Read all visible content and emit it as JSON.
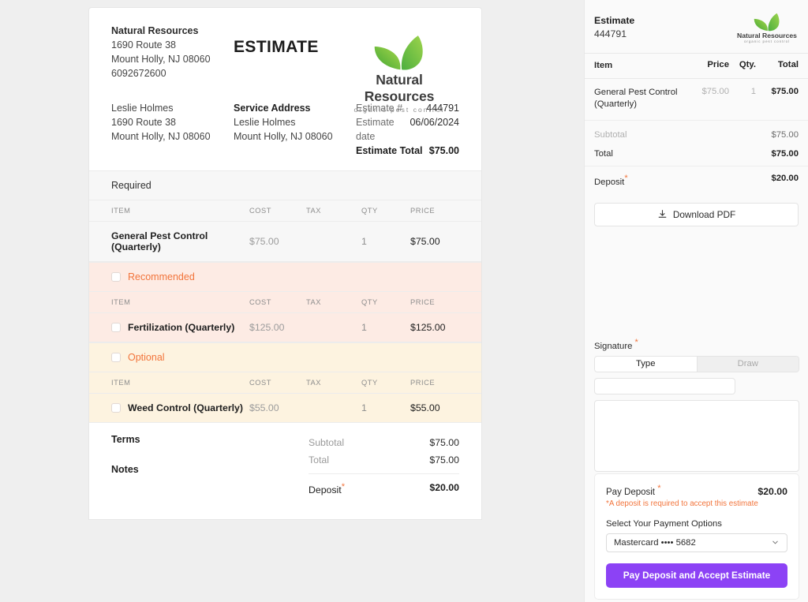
{
  "document": {
    "business": {
      "name": "Natural Resources",
      "street": "1690 Route 38",
      "city_state_zip": "Mount Holly, NJ 08060",
      "phone": "6092672600"
    },
    "heading": "ESTIMATE",
    "logo": {
      "title": "Natural Resources",
      "subtitle": "organic pest control",
      "icon": "leaf-logo-icon",
      "green_light": "#8CC63F",
      "green_dark": "#3FA535"
    },
    "customer": {
      "name": "Leslie Holmes",
      "street": "1690 Route 38",
      "city_state_zip": "Mount Holly, NJ 08060"
    },
    "service_address": {
      "label": "Service Address",
      "name": "Leslie Holmes",
      "city_state_zip": "Mount Holly, NJ 08060"
    },
    "meta": [
      {
        "key": "Estimate #",
        "value": "444791"
      },
      {
        "key": "Estimate date",
        "value": "06/06/2024"
      },
      {
        "key": "Estimate Total",
        "value": "$75.00"
      }
    ],
    "columns": {
      "item": "ITEM",
      "cost": "COST",
      "tax": "TAX",
      "qty": "QTY",
      "price": "PRICE"
    },
    "sections": [
      {
        "label": "Required",
        "has_checkbox": false,
        "rows": [
          {
            "item": "General Pest Control (Quarterly)",
            "cost": "$75.00",
            "tax": "",
            "qty": "1",
            "price": "$75.00",
            "has_checkbox": false
          }
        ]
      },
      {
        "label": "Recommended",
        "has_checkbox": true,
        "rows": [
          {
            "item": "Fertilization (Quarterly)",
            "cost": "$125.00",
            "tax": "",
            "qty": "1",
            "price": "$125.00",
            "has_checkbox": true
          }
        ]
      },
      {
        "label": "Optional",
        "has_checkbox": true,
        "rows": [
          {
            "item": "Weed Control (Quarterly)",
            "cost": "$55.00",
            "tax": "",
            "qty": "1",
            "price": "$55.00",
            "has_checkbox": true
          }
        ]
      }
    ],
    "footer": {
      "terms_label": "Terms",
      "notes_label": "Notes",
      "subtotal_label": "Subtotal",
      "subtotal_value": "$75.00",
      "total_label": "Total",
      "total_value": "$75.00",
      "deposit_label": "Deposit",
      "deposit_value": "$20.00",
      "required_marker": "*"
    }
  },
  "panel": {
    "title": "Estimate",
    "number": "444791",
    "logo": {
      "title": "Natural Resources",
      "subtitle": "organic pest control"
    },
    "columns": {
      "item": "Item",
      "price": "Price",
      "qty": "Qty.",
      "total": "Total"
    },
    "rows": [
      {
        "item": "General Pest Control (Quarterly)",
        "price": "$75.00",
        "qty": "1",
        "total": "$75.00"
      }
    ],
    "totals": [
      {
        "key": "Subtotal",
        "value": "$75.00"
      },
      {
        "key": "Total",
        "value": "$75.00"
      },
      {
        "key": "Deposit",
        "value": "$20.00"
      }
    ],
    "download_label": "Download PDF",
    "download_icon": "download-icon",
    "signature": {
      "label": "Signature",
      "required_marker": "*",
      "tab_type": "Type",
      "tab_draw": "Draw",
      "input_value": "",
      "input_placeholder": ""
    },
    "payment": {
      "pay_label": "Pay Deposit",
      "required_marker": "*",
      "amount": "$20.00",
      "note": "*A deposit is required to accept this estimate",
      "select_label": "Select Your Payment Options",
      "selected_option": "Mastercard  ••••  5682",
      "options": [
        "Mastercard  ••••  5682"
      ],
      "chevron_icon": "chevron-down-icon",
      "submit_label": "Pay Deposit and Accept Estimate",
      "submit_color": "#8c42f5"
    }
  }
}
